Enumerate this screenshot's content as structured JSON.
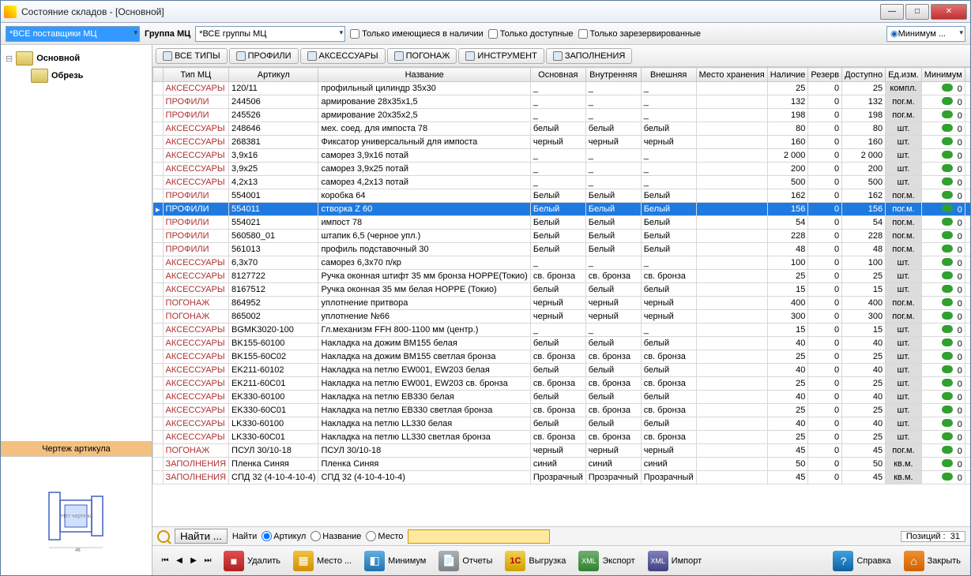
{
  "window_title": "Состояние складов - [Основной]",
  "supplier_combo": "*ВСЕ поставщики МЦ",
  "group_label": "Группа МЦ",
  "group_combo": "*ВСЕ группы МЦ",
  "checkbox1": "Только имеющиеся в наличии",
  "checkbox2": "Только доступные",
  "checkbox3": "Только зарезервированные",
  "minimum_combo": "Минимум ...",
  "tree": {
    "root": "Основной",
    "child": "Обрезь"
  },
  "preview_title": "Чертеж артикула",
  "preview_label": "Нет чертежа",
  "tabs": [
    "ВСЕ ТИПЫ",
    "ПРОФИЛИ",
    "АКСЕССУАРЫ",
    "ПОГОНАЖ",
    "ИНСТРУМЕНТ",
    "ЗАПОЛНЕНИЯ"
  ],
  "columns": [
    "",
    "Тип МЦ",
    "Артикул",
    "Название",
    "Основная",
    "Внутренняя",
    "Внешняя",
    "Место хранения",
    "Наличие",
    "Резерв",
    "Доступно",
    "Ед.изм.",
    "Минимум",
    ""
  ],
  "rows": [
    {
      "type": "АКСЕССУАРЫ",
      "art": "120/11",
      "name": "профильный цилиндр 35х30",
      "c1": "_",
      "c2": "_",
      "c3": "_",
      "loc": "",
      "avail": "25",
      "res": "0",
      "disp": "25",
      "unit": "компл.",
      "min": "0"
    },
    {
      "type": "ПРОФИЛИ",
      "art": "244506",
      "name": "армирование 28х35х1,5",
      "c1": "_",
      "c2": "_",
      "c3": "_",
      "loc": "",
      "avail": "132",
      "res": "0",
      "disp": "132",
      "unit": "пог.м.",
      "min": "0"
    },
    {
      "type": "ПРОФИЛИ",
      "art": "245526",
      "name": "армирование 20х35х2,5",
      "c1": "_",
      "c2": "_",
      "c3": "_",
      "loc": "",
      "avail": "198",
      "res": "0",
      "disp": "198",
      "unit": "пог.м.",
      "min": "0"
    },
    {
      "type": "АКСЕССУАРЫ",
      "art": "248646",
      "name": "мех. соед. для импоста 78",
      "c1": "белый",
      "c2": "белый",
      "c3": "белый",
      "loc": "",
      "avail": "80",
      "res": "0",
      "disp": "80",
      "unit": "шт.",
      "min": "0"
    },
    {
      "type": "АКСЕССУАРЫ",
      "art": "268381",
      "name": "Фиксатор универсальный для импоста",
      "c1": "черный",
      "c2": "черный",
      "c3": "черный",
      "loc": "",
      "avail": "160",
      "res": "0",
      "disp": "160",
      "unit": "шт.",
      "min": "0"
    },
    {
      "type": "АКСЕССУАРЫ",
      "art": "3,9x16",
      "name": "саморез 3,9х16 потай",
      "c1": "_",
      "c2": "_",
      "c3": "_",
      "loc": "",
      "avail": "2 000",
      "res": "0",
      "disp": "2 000",
      "unit": "шт.",
      "min": "0"
    },
    {
      "type": "АКСЕССУАРЫ",
      "art": "3,9x25",
      "name": "саморез 3,9х25 потай",
      "c1": "_",
      "c2": "_",
      "c3": "_",
      "loc": "",
      "avail": "200",
      "res": "0",
      "disp": "200",
      "unit": "шт.",
      "min": "0"
    },
    {
      "type": "АКСЕССУАРЫ",
      "art": "4,2x13",
      "name": "саморез 4,2х13 потай",
      "c1": "_",
      "c2": "_",
      "c3": "_",
      "loc": "",
      "avail": "500",
      "res": "0",
      "disp": "500",
      "unit": "шт.",
      "min": "0"
    },
    {
      "type": "ПРОФИЛИ",
      "art": "554001",
      "name": "коробка 64",
      "c1": "Белый",
      "c2": "Белый",
      "c3": "Белый",
      "loc": "",
      "avail": "162",
      "res": "0",
      "disp": "162",
      "unit": "пог.м.",
      "min": "0"
    },
    {
      "type": "ПРОФИЛИ",
      "art": "554011",
      "name": "створка Z 60",
      "c1": "Белый",
      "c2": "Белый",
      "c3": "Белый",
      "loc": "",
      "avail": "156",
      "res": "0",
      "disp": "156",
      "unit": "пог.м.",
      "min": "0",
      "selected": true,
      "mark": "▸"
    },
    {
      "type": "ПРОФИЛИ",
      "art": "554021",
      "name": "импост 78",
      "c1": "Белый",
      "c2": "Белый",
      "c3": "Белый",
      "loc": "",
      "avail": "54",
      "res": "0",
      "disp": "54",
      "unit": "пог.м.",
      "min": "0"
    },
    {
      "type": "ПРОФИЛИ",
      "art": "560580_01",
      "name": "штапик 6,5 (черное упл.)",
      "c1": "Белый",
      "c2": "Белый",
      "c3": "Белый",
      "loc": "",
      "avail": "228",
      "res": "0",
      "disp": "228",
      "unit": "пог.м.",
      "min": "0"
    },
    {
      "type": "ПРОФИЛИ",
      "art": "561013",
      "name": "профиль подставочный 30",
      "c1": "Белый",
      "c2": "Белый",
      "c3": "Белый",
      "loc": "",
      "avail": "48",
      "res": "0",
      "disp": "48",
      "unit": "пог.м.",
      "min": "0"
    },
    {
      "type": "АКСЕССУАРЫ",
      "art": "6,3x70",
      "name": "саморез 6,3х70 п/кр",
      "c1": "_",
      "c2": "_",
      "c3": "_",
      "loc": "",
      "avail": "100",
      "res": "0",
      "disp": "100",
      "unit": "шт.",
      "min": "0"
    },
    {
      "type": "АКСЕССУАРЫ",
      "art": "8127722",
      "name": "Ручка оконная штифт 35 мм бронза HOPPE(Токио)",
      "c1": "св. бронза",
      "c2": "св. бронза",
      "c3": "св. бронза",
      "loc": "",
      "avail": "25",
      "res": "0",
      "disp": "25",
      "unit": "шт.",
      "min": "0"
    },
    {
      "type": "АКСЕССУАРЫ",
      "art": "8167512",
      "name": "Ручка оконная 35 мм белая HOPPE (Токио)",
      "c1": "белый",
      "c2": "белый",
      "c3": "белый",
      "loc": "",
      "avail": "15",
      "res": "0",
      "disp": "15",
      "unit": "шт.",
      "min": "0"
    },
    {
      "type": "ПОГОНАЖ",
      "art": "864952",
      "name": "уплотнение притвора",
      "c1": "черный",
      "c2": "черный",
      "c3": "черный",
      "loc": "",
      "avail": "400",
      "res": "0",
      "disp": "400",
      "unit": "пог.м.",
      "min": "0"
    },
    {
      "type": "ПОГОНАЖ",
      "art": "865002",
      "name": "уплотнение №66",
      "c1": "черный",
      "c2": "черный",
      "c3": "черный",
      "loc": "",
      "avail": "300",
      "res": "0",
      "disp": "300",
      "unit": "пог.м.",
      "min": "0"
    },
    {
      "type": "АКСЕССУАРЫ",
      "art": "BGMK3020-100",
      "name": "Гл.механизм FFH  800-1100 мм (центр.)",
      "c1": "_",
      "c2": "_",
      "c3": "_",
      "loc": "",
      "avail": "15",
      "res": "0",
      "disp": "15",
      "unit": "шт.",
      "min": "0"
    },
    {
      "type": "АКСЕССУАРЫ",
      "art": "BK155-60100",
      "name": "Накладка на дожим BM155 белая",
      "c1": "белый",
      "c2": "белый",
      "c3": "белый",
      "loc": "",
      "avail": "40",
      "res": "0",
      "disp": "40",
      "unit": "шт.",
      "min": "0"
    },
    {
      "type": "АКСЕССУАРЫ",
      "art": "BK155-60C02",
      "name": "Накладка на дожим BM155 светлая бронза",
      "c1": "св. бронза",
      "c2": "св. бронза",
      "c3": "св. бронза",
      "loc": "",
      "avail": "25",
      "res": "0",
      "disp": "25",
      "unit": "шт.",
      "min": "0"
    },
    {
      "type": "АКСЕССУАРЫ",
      "art": "EK211-60102",
      "name": "Накладка на петлю EW001, EW203 белая",
      "c1": "белый",
      "c2": "белый",
      "c3": "белый",
      "loc": "",
      "avail": "40",
      "res": "0",
      "disp": "40",
      "unit": "шт.",
      "min": "0"
    },
    {
      "type": "АКСЕССУАРЫ",
      "art": "EK211-60C01",
      "name": "Накладка на петлю EW001, EW203 св. бронза",
      "c1": "св. бронза",
      "c2": "св. бронза",
      "c3": "св. бронза",
      "loc": "",
      "avail": "25",
      "res": "0",
      "disp": "25",
      "unit": "шт.",
      "min": "0"
    },
    {
      "type": "АКСЕССУАРЫ",
      "art": "EK330-60100",
      "name": "Накладка на петлю EB330 белая",
      "c1": "белый",
      "c2": "белый",
      "c3": "белый",
      "loc": "",
      "avail": "40",
      "res": "0",
      "disp": "40",
      "unit": "шт.",
      "min": "0"
    },
    {
      "type": "АКСЕССУАРЫ",
      "art": "EK330-60C01",
      "name": "Накладка на петлю EB330 светлая бронза",
      "c1": "св. бронза",
      "c2": "св. бронза",
      "c3": "св. бронза",
      "loc": "",
      "avail": "25",
      "res": "0",
      "disp": "25",
      "unit": "шт.",
      "min": "0"
    },
    {
      "type": "АКСЕССУАРЫ",
      "art": "LK330-60100",
      "name": "Накладка на петлю LL330 белая",
      "c1": "белый",
      "c2": "белый",
      "c3": "белый",
      "loc": "",
      "avail": "40",
      "res": "0",
      "disp": "40",
      "unit": "шт.",
      "min": "0"
    },
    {
      "type": "АКСЕССУАРЫ",
      "art": "LK330-60C01",
      "name": "Накладка на петлю LL330 светлая бронза",
      "c1": "св. бронза",
      "c2": "св. бронза",
      "c3": "св. бронза",
      "loc": "",
      "avail": "25",
      "res": "0",
      "disp": "25",
      "unit": "шт.",
      "min": "0"
    },
    {
      "type": "ПОГОНАЖ",
      "art": "ПСУЛ 30/10-18",
      "name": "ПСУЛ 30/10-18",
      "c1": "черный",
      "c2": "черный",
      "c3": "черный",
      "loc": "",
      "avail": "45",
      "res": "0",
      "disp": "45",
      "unit": "пог.м.",
      "min": "0"
    },
    {
      "type": "ЗАПОЛНЕНИЯ",
      "art": "Пленка Синяя",
      "name": "Пленка Синяя",
      "c1": "синий",
      "c2": "синий",
      "c3": "синий",
      "loc": "",
      "avail": "50",
      "res": "0",
      "disp": "50",
      "unit": "кв.м.",
      "min": "0"
    },
    {
      "type": "ЗАПОЛНЕНИЯ",
      "art": "СПД 32 (4-10-4-10-4)",
      "name": "СПД 32 (4-10-4-10-4)",
      "c1": "Прозрачный",
      "c2": "Прозрачный",
      "c3": "Прозрачный",
      "loc": "",
      "avail": "45",
      "res": "0",
      "disp": "45",
      "unit": "кв.м.",
      "min": "0"
    }
  ],
  "find": {
    "btn": "Найти ...",
    "lbl": "Найти",
    "r1": "Артикул",
    "r2": "Название",
    "r3": "Место",
    "pos_lbl": "Позиций :",
    "pos_val": "31"
  },
  "bottom": {
    "del": "Удалить",
    "loc": "Место ...",
    "min": "Минимум",
    "rep": "Отчеты",
    "upl": "Выгрузка",
    "exp": "Экспорт",
    "imp": "Импорт",
    "help": "Справка",
    "close": "Закрыть"
  }
}
